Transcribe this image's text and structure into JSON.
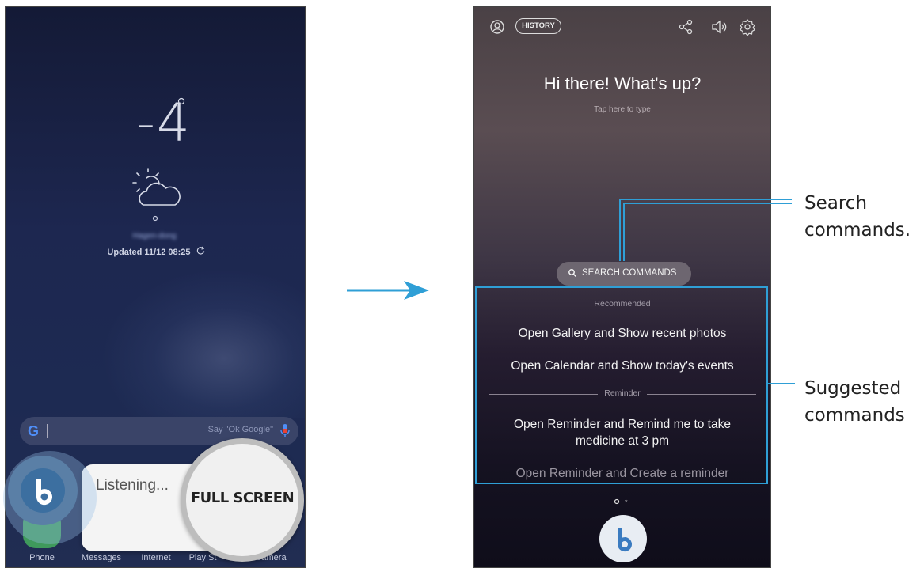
{
  "left_phone": {
    "temperature": "-4",
    "location": "Hagen-dong",
    "updated": "Updated 11/12 08:25",
    "google_bar": {
      "logo": "G",
      "placeholder": "Say \"Ok Google\""
    },
    "dock": [
      "Phone",
      "Messages",
      "Internet",
      "Play St",
      "Camera"
    ],
    "listening": "Listening...",
    "full_screen": "FULL SCREEN"
  },
  "right_phone": {
    "history": "HISTORY",
    "greeting": "Hi there! What's up?",
    "tap_to_type": "Tap here to type",
    "search_commands": "SEARCH COMMANDS",
    "sections": [
      {
        "header": "Recommended",
        "commands": [
          "Open Gallery and Show recent photos",
          "Open Calendar and Show today's events"
        ]
      },
      {
        "header": "Reminder",
        "commands": [
          "Open Reminder and Remind me to take medicine at 3 pm",
          "Open Reminder and Create a reminder"
        ]
      }
    ]
  },
  "callouts": {
    "search": [
      "Search",
      "commands."
    ],
    "suggested": [
      "Suggested",
      "commands"
    ]
  },
  "colors": {
    "accent": "#2f9fd6",
    "left_bg": "#1d2750",
    "right_bg": "#4a4145"
  }
}
